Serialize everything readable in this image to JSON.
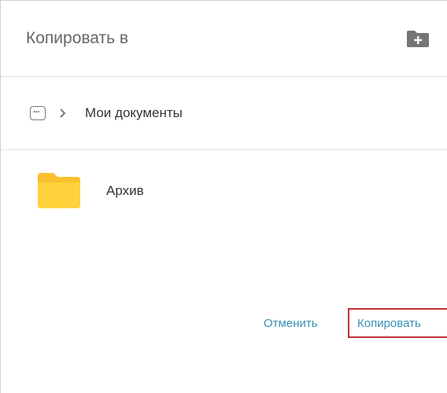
{
  "dialog": {
    "title": "Копировать в",
    "new_folder_icon": "folder-plus-icon"
  },
  "breadcrumb": {
    "more_icon": "ellipsis-icon",
    "separator_icon": "chevron-right-icon",
    "current": "Мои документы"
  },
  "folders": [
    {
      "name": "Архив",
      "icon": "folder-icon",
      "color": "#fbc02d"
    }
  ],
  "actions": {
    "cancel_label": "Отменить",
    "copy_label": "Копировать"
  },
  "colors": {
    "accent": "#3a8fb5",
    "highlight_border": "#c0313c",
    "folder": "#fbc02d"
  }
}
